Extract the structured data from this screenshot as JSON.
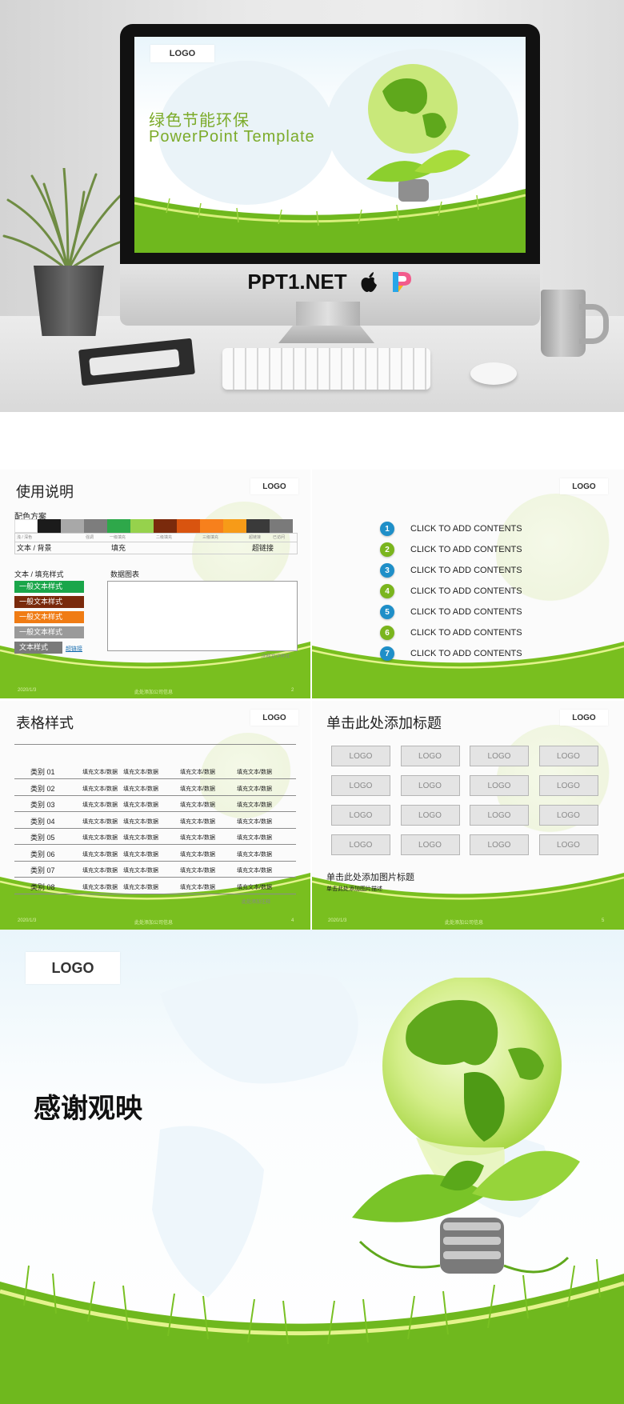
{
  "hero": {
    "logo": "LOGO",
    "title_cn": "绿色节能环保",
    "title_en": "PowerPoint Template",
    "brand": "PPT1.NET",
    "apple_icon": "apple-icon",
    "p_logo_icon": "p-logo-icon"
  },
  "slide_usage": {
    "title": "使用说明",
    "logo": "LOGO",
    "palette_label": "配色方案",
    "swatches": [
      "#ffffff",
      "#1b1b1b",
      "#a8a8a8",
      "#7d7d7d",
      "#2ea84a",
      "#96d24c",
      "#7a2a0c",
      "#d9540f",
      "#f7801c",
      "#f79b18",
      "#3a3a3a",
      "#7a7a7a"
    ],
    "swatch_labels": [
      "浅 / 深色",
      "强调",
      "一级填充",
      "二级填充",
      "三级填充",
      "超链接",
      "已访问"
    ],
    "row_labels": [
      "文本 / 背景",
      "填充",
      "超链接"
    ],
    "text_fill_label": "文本 / 填充样式",
    "chart_label": "数据图表",
    "styles": [
      {
        "text": "一般文本样式",
        "color": "#1aa64a"
      },
      {
        "text": "一般文本样式",
        "color": "#7a2a0c"
      },
      {
        "text": "一般文本样式",
        "color": "#f07c14"
      },
      {
        "text": "一般文本样式",
        "color": "#9a9a9a"
      },
      {
        "text": "文本样式",
        "color": "#7a7a7a"
      }
    ],
    "hyperlink": "超链接",
    "chart_note": "注释文字样式",
    "footer_date": "2020/1/3",
    "footer_company": "此处添加公司信息",
    "page": "2"
  },
  "slide_contents": {
    "logo": "LOGO",
    "items": [
      {
        "num": "1",
        "text": "CLICK TO ADD CONTENTS",
        "color": "#1f8fc8"
      },
      {
        "num": "2",
        "text": "CLICK TO ADD CONTENTS",
        "color": "#7ab51d"
      },
      {
        "num": "3",
        "text": "CLICK TO ADD CONTENTS",
        "color": "#1f8fc8"
      },
      {
        "num": "4",
        "text": "CLICK TO ADD CONTENTS",
        "color": "#7ab51d"
      },
      {
        "num": "5",
        "text": "CLICK TO ADD CONTENTS",
        "color": "#1f8fc8"
      },
      {
        "num": "6",
        "text": "CLICK TO ADD CONTENTS",
        "color": "#7ab51d"
      },
      {
        "num": "7",
        "text": "CLICK TO ADD CONTENTS",
        "color": "#1f8fc8"
      }
    ]
  },
  "slide_table": {
    "title": "表格样式",
    "logo": "LOGO",
    "rows": [
      {
        "cat": "类别 01",
        "cells": [
          "填充文本/数据",
          "填充文本/数据",
          "填充文本/数据",
          "填充文本/数据"
        ]
      },
      {
        "cat": "类别 02",
        "cells": [
          "填充文本/数据",
          "填充文本/数据",
          "填充文本/数据",
          "填充文本/数据"
        ]
      },
      {
        "cat": "类别 03",
        "cells": [
          "填充文本/数据",
          "填充文本/数据",
          "填充文本/数据",
          "填充文本/数据"
        ]
      },
      {
        "cat": "类别 04",
        "cells": [
          "填充文本/数据",
          "填充文本/数据",
          "填充文本/数据",
          "填充文本/数据"
        ]
      },
      {
        "cat": "类别 05",
        "cells": [
          "填充文本/数据",
          "填充文本/数据",
          "填充文本/数据",
          "填充文本/数据"
        ]
      },
      {
        "cat": "类别 06",
        "cells": [
          "填充文本/数据",
          "填充文本/数据",
          "填充文本/数据",
          "填充文本/数据"
        ]
      },
      {
        "cat": "类别 07",
        "cells": [
          "填充文本/数据",
          "填充文本/数据",
          "填充文本/数据",
          "填充文本/数据"
        ]
      },
      {
        "cat": "类别 08",
        "cells": [
          "填充文本/数据",
          "填充文本/数据",
          "填充文本/数据",
          "填充文本/数据"
        ]
      }
    ],
    "note": "此处添加注释",
    "footer_date": "2020/1/3",
    "footer_company": "此处添加公司信息",
    "page": "4"
  },
  "slide_logos": {
    "title": "单击此处添加标题",
    "logo": "LOGO",
    "tile_label": "LOGO",
    "subtitle": "单击此处添加图片标题",
    "desc": "单击此处添加图片描述",
    "footer_date": "2020/1/3",
    "footer_company": "此处添加公司信息",
    "page": "5"
  },
  "final": {
    "logo": "LOGO",
    "thanks": "感谢观映"
  }
}
